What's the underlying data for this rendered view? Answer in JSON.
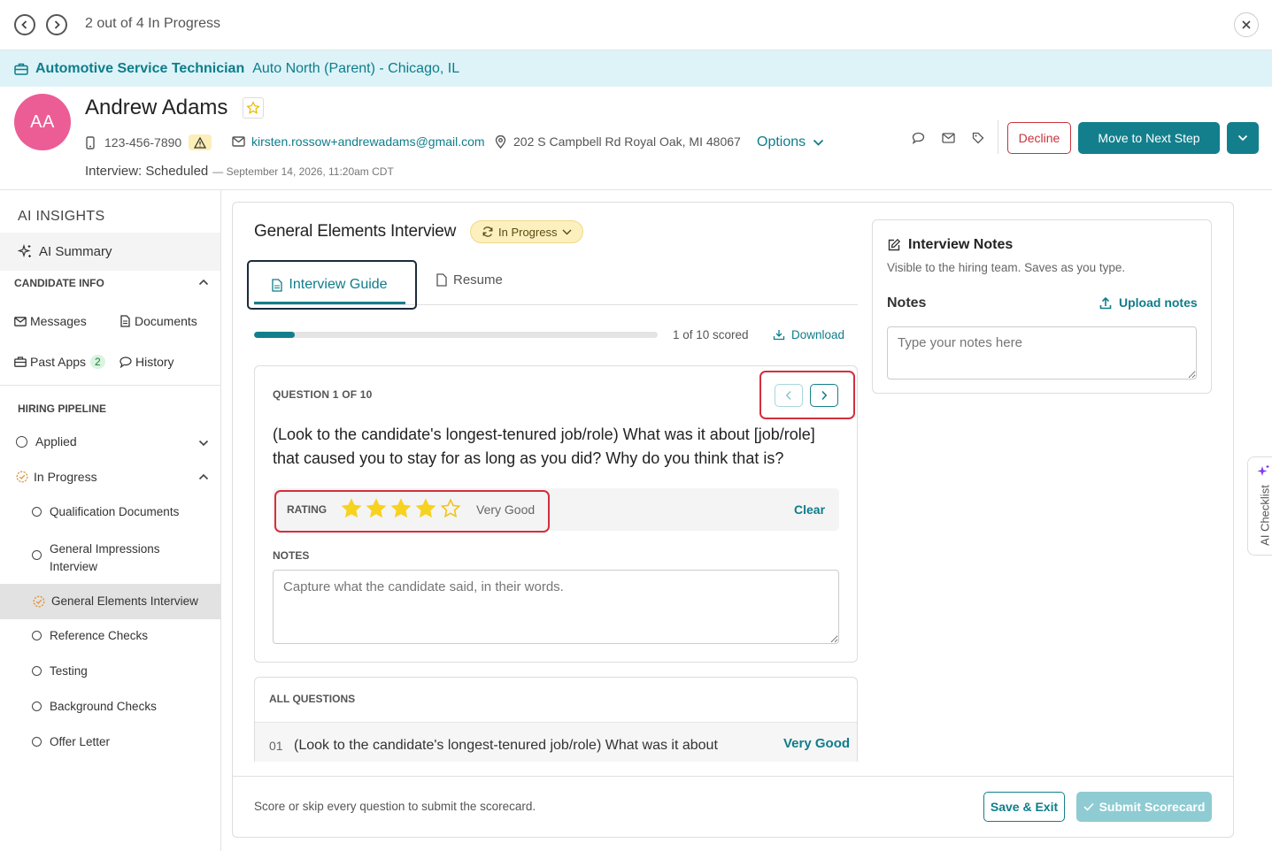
{
  "topbar": {
    "progress_text": "2 out of 4 In Progress"
  },
  "job": {
    "title": "Automotive Service Technician",
    "location": "Auto North (Parent) - Chicago, IL"
  },
  "candidate": {
    "initials": "AA",
    "name": "Andrew Adams",
    "phone": "123-456-7890",
    "email": "kirsten.rossow+andrewadams@gmail.com",
    "address": "202 S Campbell Rd Royal Oak, MI 48067",
    "options_label": "Options",
    "status": "Interview: Scheduled",
    "status_date": "— September 14, 2026, 11:20am CDT",
    "decline_label": "Decline",
    "next_step_label": "Move to Next Step"
  },
  "sidebar": {
    "ai_insights": "AI INSIGHTS",
    "ai_summary": "AI Summary",
    "candidate_info": "CANDIDATE INFO",
    "messages": "Messages",
    "documents": "Documents",
    "past_apps": "Past Apps",
    "past_apps_count": "2",
    "history": "History",
    "hiring_pipeline": "HIRING PIPELINE",
    "applied": "Applied",
    "in_progress": "In Progress",
    "steps": [
      "Qualification Documents",
      "General Impressions Interview",
      "General Elements Interview",
      "Reference Checks",
      "Testing",
      "Background Checks",
      "Offer Letter"
    ]
  },
  "interview": {
    "title": "General Elements Interview",
    "status_badge": "In Progress",
    "tab_guide": "Interview Guide",
    "tab_resume": "Resume",
    "scored_text": "1 of 10 scored",
    "progress_fraction": 0.1,
    "download_label": "Download",
    "question_counter": "QUESTION 1 OF 10",
    "question_text": "(Look to the candidate's longest-tenured job/role) What was it about [job/role] that caused you to stay for as long as you did? Why do you think that is?",
    "rating_label": "RATING",
    "rating_value": 4,
    "rating_max": 5,
    "rating_text": "Very Good",
    "clear_label": "Clear",
    "notes_label": "NOTES",
    "notes_placeholder": "Capture what the candidate said, in their words.",
    "all_questions_label": "ALL QUESTIONS",
    "all_questions": [
      {
        "num": "01",
        "text": "(Look to the candidate's longest-tenured job/role) What was it about",
        "rating": "Very Good"
      }
    ],
    "footer_hint": "Score or skip every question to submit the scorecard.",
    "save_exit": "Save & Exit",
    "submit": "Submit Scorecard"
  },
  "notes_panel": {
    "title": "Interview Notes",
    "subtitle": "Visible to the hiring team. Saves as you type.",
    "notes_label": "Notes",
    "upload_label": "Upload notes",
    "placeholder": "Type your notes here"
  },
  "ai_checklist": {
    "label": "AI Checklist"
  },
  "colors": {
    "teal": "#137f8c",
    "accent_pink": "#ec5d95",
    "decline_red": "#c8323c",
    "star": "#f7d21f",
    "job_bar": "#ddf3f8"
  }
}
